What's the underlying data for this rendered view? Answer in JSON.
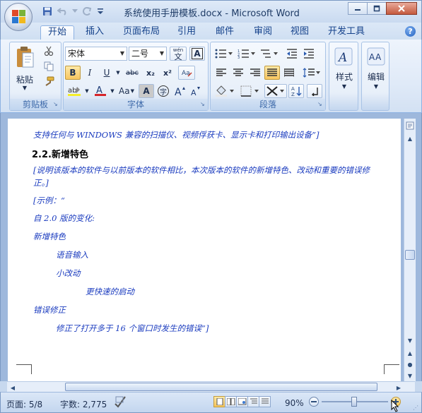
{
  "window": {
    "title": "系统使用手册模板.docx - Microsoft Word"
  },
  "tabs": [
    {
      "label": "开始",
      "active": true
    },
    {
      "label": "插入"
    },
    {
      "label": "页面布局"
    },
    {
      "label": "引用"
    },
    {
      "label": "邮件"
    },
    {
      "label": "审阅"
    },
    {
      "label": "视图"
    },
    {
      "label": "开发工具"
    }
  ],
  "ribbon": {
    "clipboard": {
      "label": "剪贴板",
      "paste_label": "粘贴"
    },
    "font": {
      "label": "字体",
      "font_name": "宋体",
      "font_size": "二号",
      "bold": "B",
      "italic": "I",
      "underline": "U",
      "strike": "abc",
      "subscript": "x₂",
      "superscript": "x²",
      "aa_label": "Aa",
      "a_label": "A",
      "wen_label": "wén",
      "wen_char": "文",
      "zi_char": "字"
    },
    "paragraph": {
      "label": "段落"
    },
    "styles": {
      "label": "样式"
    },
    "editing": {
      "label": "编辑"
    }
  },
  "document": {
    "line1": "支持任何与 WINDOWS 兼容的扫描仪、视频俘获卡、显示卡和打印输出设备”]",
    "heading": "2.2.新增特色",
    "line2a": "[说明该版本的软件与以前版本的软件相比，本次版本的软件的新增特色、改动和重要的错误修",
    "line2b": "正。]",
    "line3": "[示例：“",
    "line4": "自 2.0 版的变化:",
    "line5": "新增特色",
    "line6": "语音输入",
    "line7": "小改动",
    "line8": "更快速的启动",
    "line9": "错误修正",
    "line10": "修正了打开多于 16 个窗口时发生的错误”]"
  },
  "status": {
    "page": "页面: 5/8",
    "words": "字数: 2,775",
    "zoom": "90%"
  },
  "colors": {
    "doc_text": "#1a3bbf",
    "ribbon_label": "#3e6aaa",
    "accent": "#15428b"
  }
}
